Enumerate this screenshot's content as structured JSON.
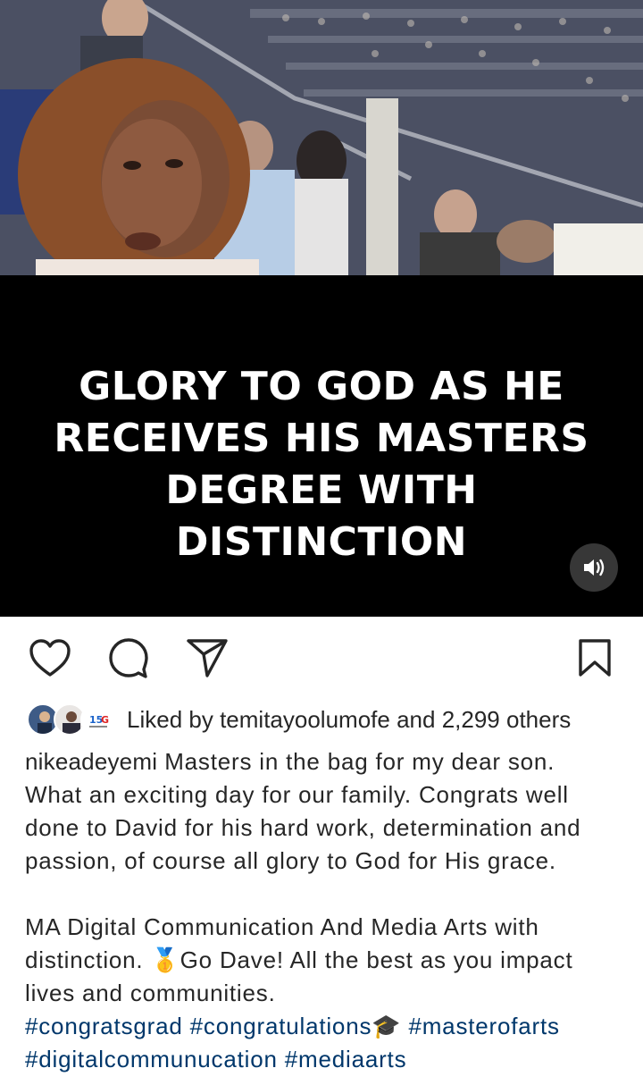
{
  "media": {
    "overlay_lines": [
      "GLORY TO GOD AS HE",
      "RECEIVES HIS MASTERS",
      "DEGREE WITH",
      "DISTINCTION"
    ],
    "sound_icon": "speaker-on-icon"
  },
  "actions": {
    "like_icon": "heart-icon",
    "comment_icon": "comment-icon",
    "share_icon": "send-icon",
    "save_icon": "bookmark-icon"
  },
  "likes": {
    "prefix": "Liked by",
    "user": "temitayoolumofe",
    "connector": "and",
    "count": "2,299 others"
  },
  "post": {
    "author": "nikeadeyemi",
    "text_1": " Masters in the bag for my dear son. What an exciting day for our family. Congrats well done to David for his hard work, determination and passion, of course all glory to God for His grace.",
    "text_2": "MA Digital  Communication And Media Arts with distinction. 🥇Go Dave! All the best as you impact lives and communities.",
    "hashtags": [
      "#congratsgrad",
      "#congratulations🎓",
      "#masterofarts",
      "#digitalcommunucation",
      "#mediaarts"
    ]
  },
  "colors": {
    "hashtag": "#00376b",
    "text": "#262626",
    "media_bg": "#000000"
  }
}
